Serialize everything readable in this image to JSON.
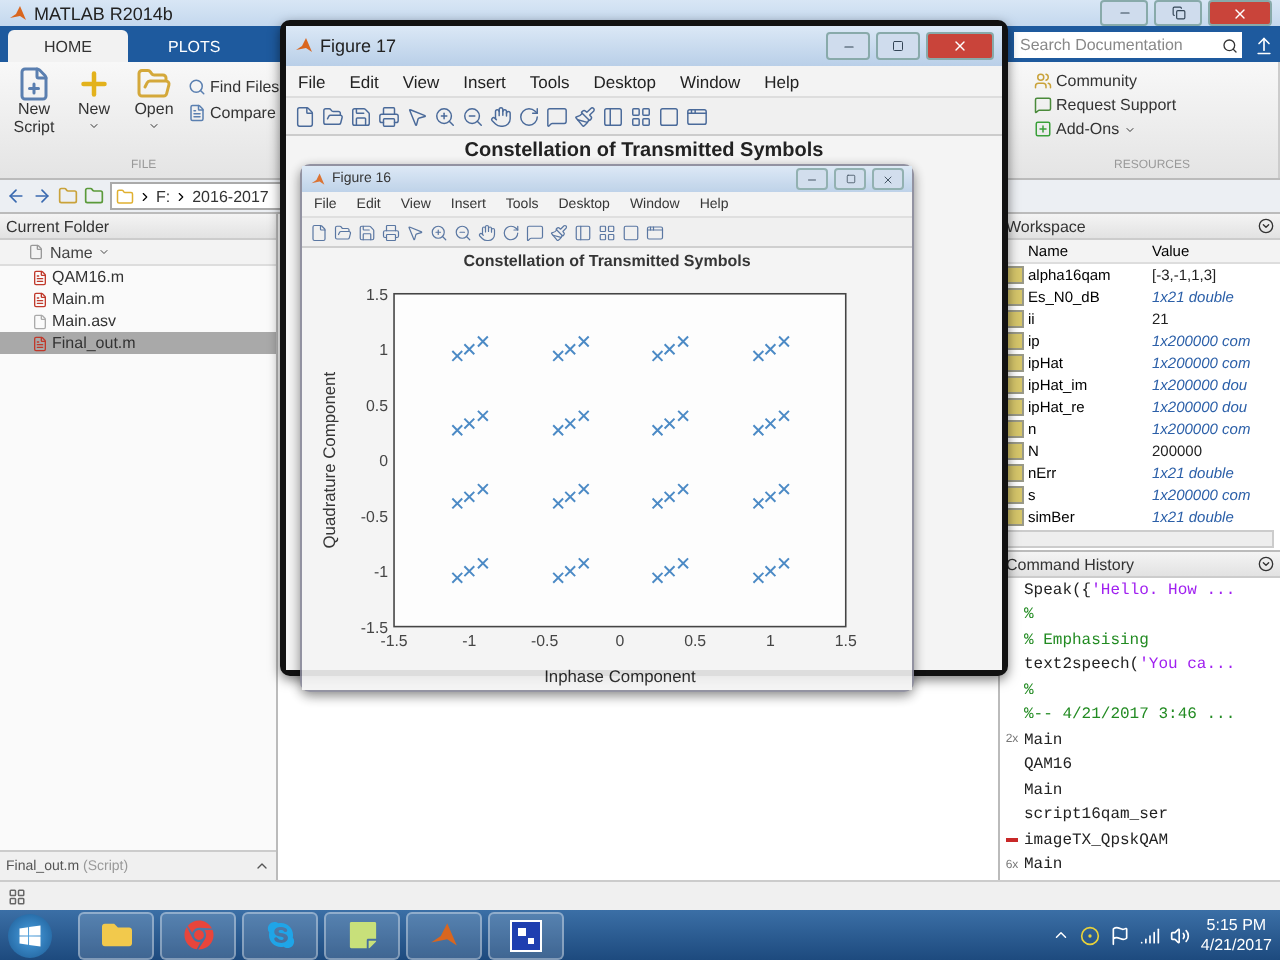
{
  "main_window": {
    "title": "MATLAB R2014b"
  },
  "ribbon": {
    "tabs": [
      {
        "label": "HOME",
        "selected": true
      },
      {
        "label": "PLOTS",
        "selected": false
      }
    ],
    "search": {
      "placeholder": "Search Documentation"
    },
    "file_section": {
      "label": "FILE",
      "large_buttons": [
        {
          "label": "New Script",
          "dropdown": false
        },
        {
          "label": "New",
          "dropdown": true
        },
        {
          "label": "Open",
          "dropdown": true
        }
      ],
      "small_buttons": [
        "Find Files",
        "Compare"
      ]
    },
    "resources_section": {
      "label": "RESOURCES",
      "items": [
        {
          "label": "Community",
          "dropdown": false
        },
        {
          "label": "Request Support",
          "dropdown": false
        },
        {
          "label": "Add-Ons",
          "dropdown": true
        }
      ]
    }
  },
  "address_bar": {
    "segments": [
      "F:",
      "2016-2017"
    ]
  },
  "current_folder": {
    "title": "Current Folder",
    "column": "Name",
    "files": [
      {
        "name": "QAM16.m",
        "kind": "script",
        "selected": false
      },
      {
        "name": "Main.m",
        "kind": "script",
        "selected": false
      },
      {
        "name": "Main.asv",
        "kind": "autosave",
        "selected": false
      },
      {
        "name": "Final_out.m",
        "kind": "script",
        "selected": true
      }
    ],
    "details": {
      "name": "Final_out.m",
      "type": "(Script)"
    }
  },
  "workspace": {
    "title": "Workspace",
    "columns": [
      "Name",
      "Value"
    ],
    "variables": [
      {
        "name": "alpha16qam",
        "value": "[-3,-1,1,3]",
        "kind": "value"
      },
      {
        "name": "Es_N0_dB",
        "value": "1x21 double",
        "kind": "summary"
      },
      {
        "name": "ii",
        "value": "21",
        "kind": "value"
      },
      {
        "name": "ip",
        "value": "1x200000 com",
        "kind": "summary"
      },
      {
        "name": "ipHat",
        "value": "1x200000 com",
        "kind": "summary"
      },
      {
        "name": "ipHat_im",
        "value": "1x200000 dou",
        "kind": "summary"
      },
      {
        "name": "ipHat_re",
        "value": "1x200000 dou",
        "kind": "summary"
      },
      {
        "name": "n",
        "value": "1x200000 com",
        "kind": "summary"
      },
      {
        "name": "N",
        "value": "200000",
        "kind": "value"
      },
      {
        "name": "nErr",
        "value": "1x21 double",
        "kind": "summary"
      },
      {
        "name": "s",
        "value": "1x200000 com",
        "kind": "summary"
      },
      {
        "name": "simBer",
        "value": "1x21 double",
        "kind": "summary"
      }
    ]
  },
  "command_history": {
    "title": "Command History",
    "entries": [
      {
        "kind": "call",
        "code": "Speak({",
        "string": "'Hello. How ...",
        "error": false
      },
      {
        "kind": "comment",
        "text": "%",
        "error": false
      },
      {
        "kind": "comment",
        "text": "% Emphasising",
        "error": false
      },
      {
        "kind": "call",
        "code": "text2speech(",
        "string": "'You ca...",
        "error": false
      },
      {
        "kind": "comment",
        "text": "%",
        "error": false
      },
      {
        "kind": "session",
        "text": "%-- 4/21/2017 3:46 ...",
        "error": false
      },
      {
        "kind": "command",
        "text": "Main",
        "count": "2x",
        "error": false
      },
      {
        "kind": "command",
        "text": "QAM16",
        "error": false
      },
      {
        "kind": "command",
        "text": "Main",
        "error": false
      },
      {
        "kind": "command",
        "text": "script16qam_ser",
        "error": false
      },
      {
        "kind": "command",
        "text": "imageTX_QpskQAM",
        "error": true
      },
      {
        "kind": "command",
        "text": "Main",
        "count": "6x",
        "error": false
      }
    ]
  },
  "figure_17": {
    "title": "Figure 17",
    "menu": [
      "File",
      "Edit",
      "View",
      "Insert",
      "Tools",
      "Desktop",
      "Window",
      "Help"
    ],
    "axes_title": "Constellation of Transmitted Symbols"
  },
  "figure_16": {
    "title": "Figure 16",
    "menu": [
      "File",
      "Edit",
      "View",
      "Insert",
      "Tools",
      "Desktop",
      "Window",
      "Help"
    ],
    "chart_data": {
      "type": "scatter",
      "title": "Constellation of Transmitted Symbols",
      "xlabel": "Inphase Component",
      "ylabel": "Quadrature Component",
      "x": [
        -1,
        -0.91,
        -1.08,
        -0.33,
        -0.24,
        -0.41,
        0.33,
        0.42,
        0.25,
        1,
        1.09,
        0.92,
        -1,
        -0.91,
        -1.08,
        -0.33,
        -0.24,
        -0.41,
        0.33,
        0.42,
        0.25,
        1,
        1.09,
        0.92,
        -1,
        -0.91,
        -1.08,
        -0.33,
        -0.24,
        -0.41,
        0.33,
        0.42,
        0.25,
        1,
        1.09,
        0.92,
        -1,
        -0.91,
        -1.08,
        -0.33,
        -0.24,
        -0.41,
        0.33,
        0.42,
        0.25,
        1,
        1.09,
        0.92
      ],
      "series": [
        {
          "color": "#3a7fc1",
          "values": [
            1,
            1.07,
            0.94,
            1,
            1.07,
            0.94,
            1,
            1.07,
            0.94,
            1,
            1.07,
            0.94,
            0.33,
            0.4,
            0.27,
            0.33,
            0.4,
            0.27,
            0.33,
            0.4,
            0.27,
            0.33,
            0.4,
            0.27,
            -0.33,
            -0.26,
            -0.39,
            -0.33,
            -0.26,
            -0.39,
            -0.33,
            -0.26,
            -0.39,
            -0.33,
            -0.26,
            -0.39,
            -1,
            -0.93,
            -1.06,
            -1,
            -0.93,
            -1.06,
            -1,
            -0.93,
            -1.06,
            -1,
            -0.93,
            -1.06
          ]
        }
      ],
      "xlim": [
        -1.5,
        1.5
      ],
      "ylim": [
        -1.5,
        1.5
      ],
      "xticks": [
        -1.5,
        -1,
        -0.5,
        0,
        0.5,
        1,
        1.5
      ],
      "yticks": [
        -1.5,
        -1,
        -0.5,
        0,
        0.5,
        1,
        1.5
      ]
    }
  },
  "taskbar": {
    "apps": [
      {
        "kind": "explorer"
      },
      {
        "kind": "chrome"
      },
      {
        "kind": "skype"
      },
      {
        "kind": "notes"
      },
      {
        "kind": "matlab"
      },
      {
        "kind": "figure"
      }
    ],
    "clock": {
      "time": "5:15 PM",
      "date": "4/21/2017"
    }
  }
}
